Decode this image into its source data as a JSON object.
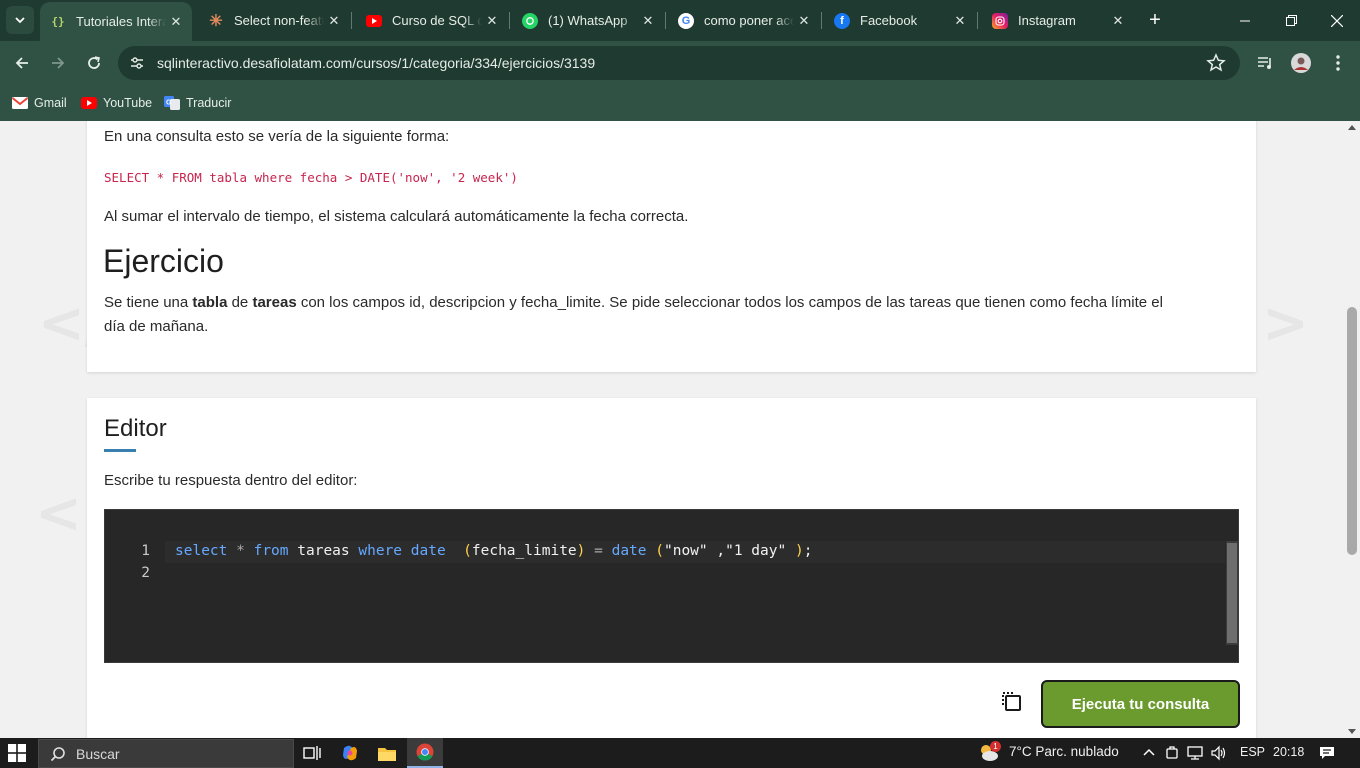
{
  "browser": {
    "tabs": [
      {
        "title": "Tutoriales Intera",
        "favicon": "code-brackets-icon",
        "active": true
      },
      {
        "title": "Select non-featu",
        "favicon": "claude-sunburst-icon",
        "active": false
      },
      {
        "title": "Curso de SQL de",
        "favicon": "youtube-icon",
        "active": false
      },
      {
        "title": "(1) WhatsApp",
        "favicon": "whatsapp-icon",
        "active": false
      },
      {
        "title": "como poner ace",
        "favicon": "google-icon",
        "active": false
      },
      {
        "title": "Facebook",
        "favicon": "facebook-icon",
        "active": false
      },
      {
        "title": "Instagram",
        "favicon": "instagram-icon",
        "active": false
      }
    ],
    "url": "sqlinteractivo.desafiolatam.com/cursos/1/categoria/334/ejercicios/3139",
    "bookmarks": [
      {
        "label": "Gmail",
        "icon": "gmail-icon"
      },
      {
        "label": "YouTube",
        "icon": "youtube-icon"
      },
      {
        "label": "Traducir",
        "icon": "google-translate-icon"
      }
    ]
  },
  "lesson": {
    "intro": "En una consulta esto se vería de la siguiente forma:",
    "example_code": "SELECT * FROM tabla where fecha > DATE('now', '2 week')",
    "note": "Al sumar el intervalo de tiempo, el sistema calculará automáticamente la fecha correcta.",
    "exercise_heading": "Ejercicio",
    "exercise_text": {
      "t1": "Se tiene una ",
      "b1": "tabla",
      "t2": " de ",
      "b2": "tareas",
      "t3": " con los campos id, descripcion y fecha_limite. Se pide seleccionar todos los campos de las tareas que tienen como fecha límite el",
      "line2": "día de mañana."
    }
  },
  "editor": {
    "heading": "Editor",
    "instruction": "Escribe tu respuesta dentro del editor:",
    "line_numbers": [
      "1",
      "2"
    ],
    "code_tokens": {
      "select": "select",
      "star": "*",
      "from": "from",
      "table": "tareas",
      "where": "where",
      "date1": "date",
      "lp1": "(",
      "field": "fecha_limite",
      "rp1": ")",
      "eq": "=",
      "date2": "date",
      "lp2": "(",
      "arg1": "\"now\"",
      "comma": ",",
      "arg2": "\"1 day\"",
      "rp2": ")",
      "semi": ";"
    },
    "run_button": "Ejecuta tu consulta"
  },
  "taskbar": {
    "search_placeholder": "Buscar",
    "weather": "7°C  Parc. nublado",
    "weather_badge": "1",
    "language": "ESP",
    "time": "20:18"
  },
  "colors": {
    "chrome_dark": "#1f3a30",
    "chrome_toolbar": "#2f5245",
    "run_button": "#6b9a2e",
    "heading_underline": "#3a7fb2",
    "inline_code": "#c7254e",
    "editor_bg": "#272727",
    "editor_keyword": "#66a8ff",
    "editor_paren": "#ffd24d"
  }
}
